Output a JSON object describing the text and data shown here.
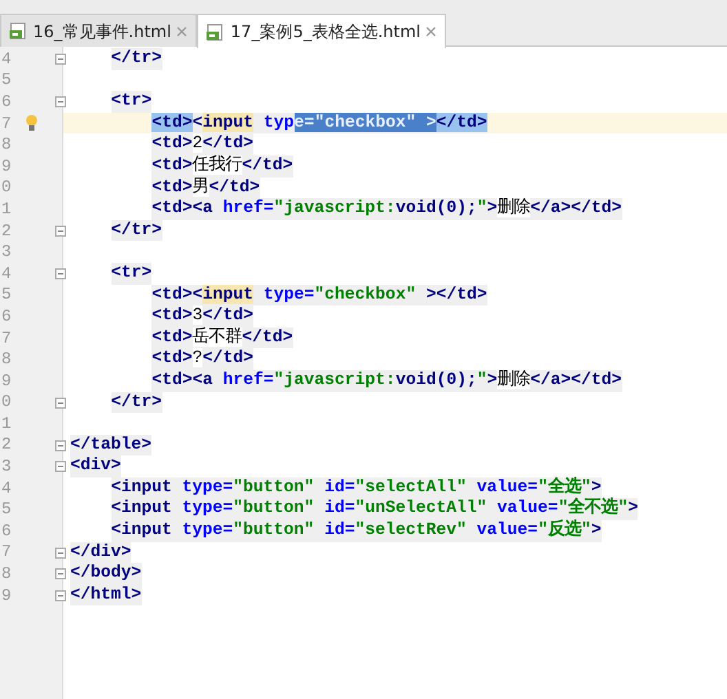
{
  "tabs": [
    {
      "label": "16_常见事件.html",
      "selected": false
    },
    {
      "label": "17_案例5_表格全选.html",
      "selected": true
    }
  ],
  "lines": [
    {
      "number": "4",
      "kind": "block",
      "fold": true,
      "tokens": [
        {
          "kind": "tag",
          "text": "</tr>"
        }
      ]
    },
    {
      "number": "5",
      "kind": "blank"
    },
    {
      "number": "6",
      "kind": "block",
      "fold": true,
      "tokens": [
        {
          "kind": "tag",
          "text": "<tr>"
        }
      ]
    },
    {
      "number": "7",
      "kind": "cell",
      "current": true,
      "bulb": true,
      "tokens": [
        {
          "kind": "tag",
          "text": "<td>",
          "matched": true
        },
        {
          "kind": "tag",
          "text": "<"
        },
        {
          "kind": "tag",
          "text": "input",
          "usage": true
        },
        {
          "kind": "attr",
          "text": " typ"
        },
        {
          "kind": "attr",
          "text": "e=",
          "selected": true
        },
        {
          "kind": "string",
          "text": "\"checkbox\" >",
          "selected": true
        },
        {
          "kind": "tag",
          "text": "</td>",
          "matched": true
        }
      ]
    },
    {
      "number": "8",
      "kind": "cell",
      "tokens": [
        {
          "kind": "tag",
          "text": "<td>"
        },
        {
          "kind": "text",
          "text": "2"
        },
        {
          "kind": "tag",
          "text": "</td>"
        }
      ]
    },
    {
      "number": "9",
      "kind": "cell",
      "tokens": [
        {
          "kind": "tag",
          "text": "<td>"
        },
        {
          "kind": "text",
          "text": "任我行"
        },
        {
          "kind": "tag",
          "text": "</td>"
        }
      ]
    },
    {
      "number": "0",
      "kind": "cell",
      "tokens": [
        {
          "kind": "tag",
          "text": "<td>"
        },
        {
          "kind": "text",
          "text": "男"
        },
        {
          "kind": "tag",
          "text": "</td>"
        }
      ]
    },
    {
      "number": "1",
      "kind": "cell",
      "tokens": [
        {
          "kind": "tag",
          "text": "<td><a "
        },
        {
          "kind": "attr",
          "text": "href="
        },
        {
          "kind": "string",
          "text": "\"javascript:"
        },
        {
          "kind": "js",
          "text": "void(0);"
        },
        {
          "kind": "string",
          "text": "\""
        },
        {
          "kind": "tag",
          "text": ">"
        },
        {
          "kind": "text",
          "text": "删除"
        },
        {
          "kind": "tag",
          "text": "</a></td>"
        }
      ]
    },
    {
      "number": "2",
      "kind": "block",
      "fold": true,
      "tokens": [
        {
          "kind": "tag",
          "text": "</tr>"
        }
      ]
    },
    {
      "number": "3",
      "kind": "blank"
    },
    {
      "number": "4",
      "kind": "block",
      "fold": true,
      "tokens": [
        {
          "kind": "tag",
          "text": "<tr>"
        }
      ]
    },
    {
      "number": "5",
      "kind": "cell",
      "tokens": [
        {
          "kind": "tag",
          "text": "<td><"
        },
        {
          "kind": "tag",
          "text": "input",
          "usage": true
        },
        {
          "kind": "attr",
          "text": " type="
        },
        {
          "kind": "string",
          "text": "\"checkbox\" "
        },
        {
          "kind": "tag",
          "text": "></td>"
        }
      ]
    },
    {
      "number": "6",
      "kind": "cell",
      "tokens": [
        {
          "kind": "tag",
          "text": "<td>"
        },
        {
          "kind": "text",
          "text": "3"
        },
        {
          "kind": "tag",
          "text": "</td>"
        }
      ]
    },
    {
      "number": "7",
      "kind": "cell",
      "tokens": [
        {
          "kind": "tag",
          "text": "<td>"
        },
        {
          "kind": "text",
          "text": "岳不群"
        },
        {
          "kind": "tag",
          "text": "</td>"
        }
      ]
    },
    {
      "number": "8",
      "kind": "cell",
      "tokens": [
        {
          "kind": "tag",
          "text": "<td>"
        },
        {
          "kind": "text",
          "text": "?"
        },
        {
          "kind": "tag",
          "text": "</td>"
        }
      ]
    },
    {
      "number": "9",
      "kind": "cell",
      "tokens": [
        {
          "kind": "tag",
          "text": "<td><a "
        },
        {
          "kind": "attr",
          "text": "href="
        },
        {
          "kind": "string",
          "text": "\"javascript:"
        },
        {
          "kind": "js",
          "text": "void(0);"
        },
        {
          "kind": "string",
          "text": "\""
        },
        {
          "kind": "tag",
          "text": ">"
        },
        {
          "kind": "text",
          "text": "删除"
        },
        {
          "kind": "tag",
          "text": "</a></td>"
        }
      ]
    },
    {
      "number": "0",
      "kind": "block",
      "fold": true,
      "tokens": [
        {
          "kind": "tag",
          "text": "</tr>"
        }
      ]
    },
    {
      "number": "1",
      "kind": "blank"
    },
    {
      "number": "2",
      "kind": "top",
      "fold": true,
      "tokens": [
        {
          "kind": "tag",
          "text": "</table>"
        }
      ]
    },
    {
      "number": "3",
      "kind": "top",
      "fold": true,
      "tokens": [
        {
          "kind": "tag",
          "text": "<div>"
        }
      ]
    },
    {
      "number": "4",
      "kind": "block",
      "tokens": [
        {
          "kind": "tag",
          "text": "<input "
        },
        {
          "kind": "attr",
          "text": "type="
        },
        {
          "kind": "string",
          "text": "\"button\" "
        },
        {
          "kind": "attr",
          "text": "id="
        },
        {
          "kind": "string",
          "text": "\"selectAll\" "
        },
        {
          "kind": "attr",
          "text": "value="
        },
        {
          "kind": "string",
          "text": "\"全选\""
        },
        {
          "kind": "tag",
          "text": ">"
        }
      ]
    },
    {
      "number": "5",
      "kind": "block",
      "tokens": [
        {
          "kind": "tag",
          "text": "<input "
        },
        {
          "kind": "attr",
          "text": "type="
        },
        {
          "kind": "string",
          "text": "\"button\" "
        },
        {
          "kind": "attr",
          "text": "id="
        },
        {
          "kind": "string",
          "text": "\"unSelectAll\" "
        },
        {
          "kind": "attr",
          "text": "value="
        },
        {
          "kind": "string",
          "text": "\"全不选\""
        },
        {
          "kind": "tag",
          "text": ">"
        }
      ]
    },
    {
      "number": "6",
      "kind": "block",
      "tokens": [
        {
          "kind": "tag",
          "text": "<input "
        },
        {
          "kind": "attr",
          "text": "type="
        },
        {
          "kind": "string",
          "text": "\"button\" "
        },
        {
          "kind": "attr",
          "text": "id="
        },
        {
          "kind": "string",
          "text": "\"selectRev\" "
        },
        {
          "kind": "attr",
          "text": "value="
        },
        {
          "kind": "string",
          "text": "\"反选\""
        },
        {
          "kind": "tag",
          "text": ">"
        }
      ]
    },
    {
      "number": "7",
      "kind": "top",
      "fold": true,
      "tokens": [
        {
          "kind": "tag",
          "text": "</div>"
        }
      ]
    },
    {
      "number": "8",
      "kind": "top",
      "fold": true,
      "tokens": [
        {
          "kind": "tag",
          "text": "</body>"
        }
      ]
    },
    {
      "number": "9",
      "kind": "top",
      "fold": true,
      "tokens": [
        {
          "kind": "tag",
          "text": "</html>"
        }
      ]
    }
  ]
}
